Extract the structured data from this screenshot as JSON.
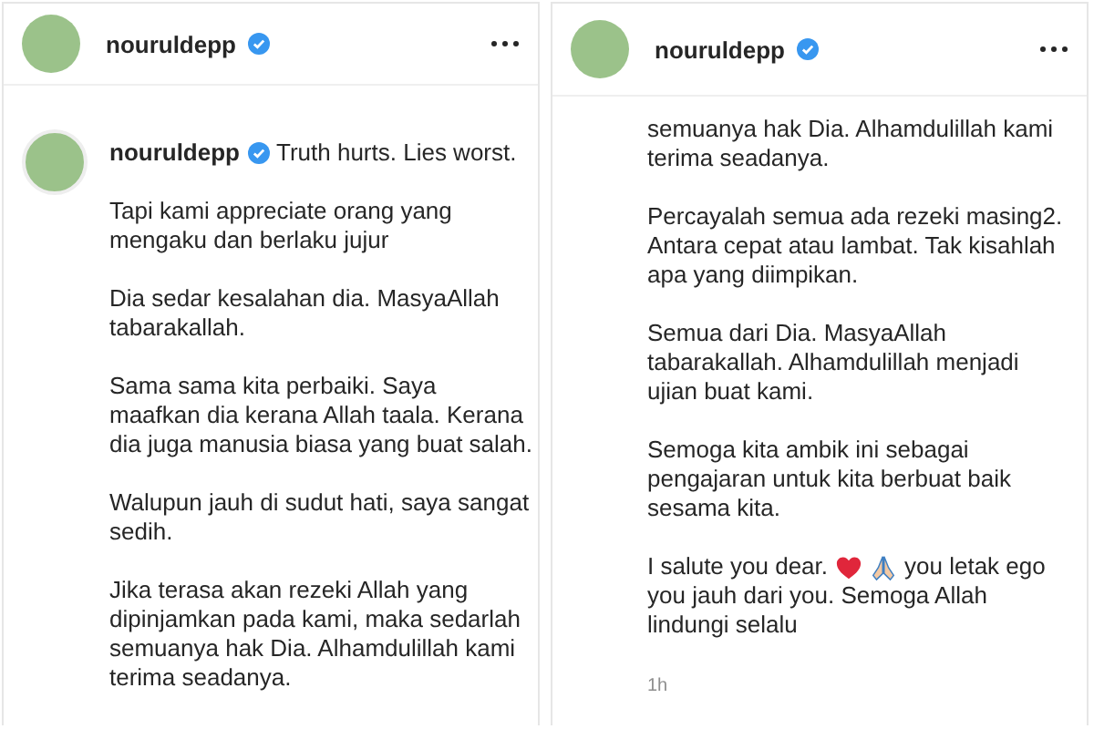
{
  "left_panel": {
    "header": {
      "username": "nouruldepp",
      "verified": true
    },
    "comment": {
      "username": "nouruldepp",
      "verified": true,
      "first_line": "Truth hurts. Lies worst.",
      "paragraphs": [
        {
          "kind": "text",
          "text": "Tapi kami appreciate orang yang mengaku dan berlaku jujur"
        },
        {
          "kind": "text",
          "text": "Dia sedar kesalahan dia. MasyaAllah tabarakallah."
        },
        {
          "kind": "text",
          "text": "Sama sama kita perbaiki. Saya maafkan dia kerana Allah taala. Kerana dia juga manusia biasa yang buat salah."
        },
        {
          "kind": "text",
          "text": "Walupun jauh di sudut hati, saya sangat sedih."
        },
        {
          "kind": "text",
          "text": "Jika terasa akan rezeki Allah yang dipinjamkan pada kami, maka sedarlah semuanya hak Dia. Alhamdulillah kami terima seadanya."
        }
      ]
    }
  },
  "right_panel": {
    "header": {
      "username": "nouruldepp",
      "verified": true
    },
    "paragraphs": [
      {
        "kind": "text",
        "text": "semuanya hak Dia. Alhamdulillah kami terima seadanya."
      },
      {
        "kind": "text",
        "text": "Percayalah semua ada rezeki masing2. Antara cepat atau lambat. Tak kisahlah apa yang diimpikan."
      },
      {
        "kind": "text",
        "text": "Semua dari Dia. MasyaAllah tabarakallah. Alhamdulillah menjadi ujian buat kami."
      },
      {
        "kind": "text",
        "text": "Semoga kita ambik ini sebagai pengajaran untuk kita berbuat baik sesama kita."
      },
      {
        "kind": "emoji",
        "lead": "I salute you dear.",
        "tail": "you letak ego",
        "rest": "you jauh dari you. Semoga Allah lindungi selalu"
      }
    ],
    "time": "1h"
  }
}
